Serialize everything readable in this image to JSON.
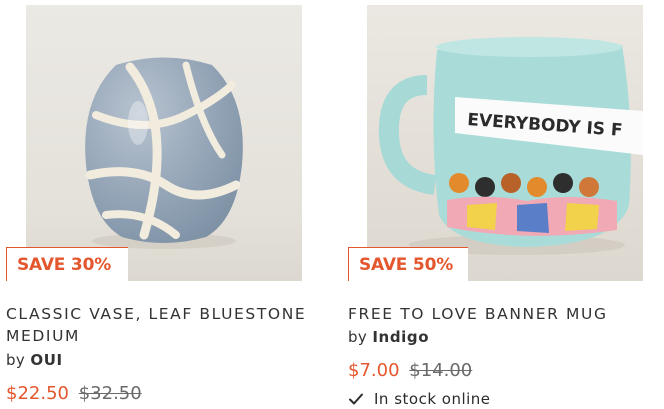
{
  "products": [
    {
      "badge": "SAVE 30%",
      "title": "CLASSIC VASE, LEAF BLUESTONE MEDIUM",
      "by_prefix": "by",
      "brand": "OUI",
      "price_now": "$22.50",
      "price_was": "$32.50",
      "image_icon": "vase-image"
    },
    {
      "badge": "SAVE 50%",
      "title": "FREE TO LOVE BANNER MUG",
      "by_prefix": "by",
      "brand": "Indigo",
      "price_now": "$7.00",
      "price_was": "$14.00",
      "stock": "In stock online",
      "image_icon": "mug-image",
      "mug_print": "EVERYBODY IS F"
    }
  ],
  "colors": {
    "accent": "#e4572e",
    "text": "#333333"
  }
}
